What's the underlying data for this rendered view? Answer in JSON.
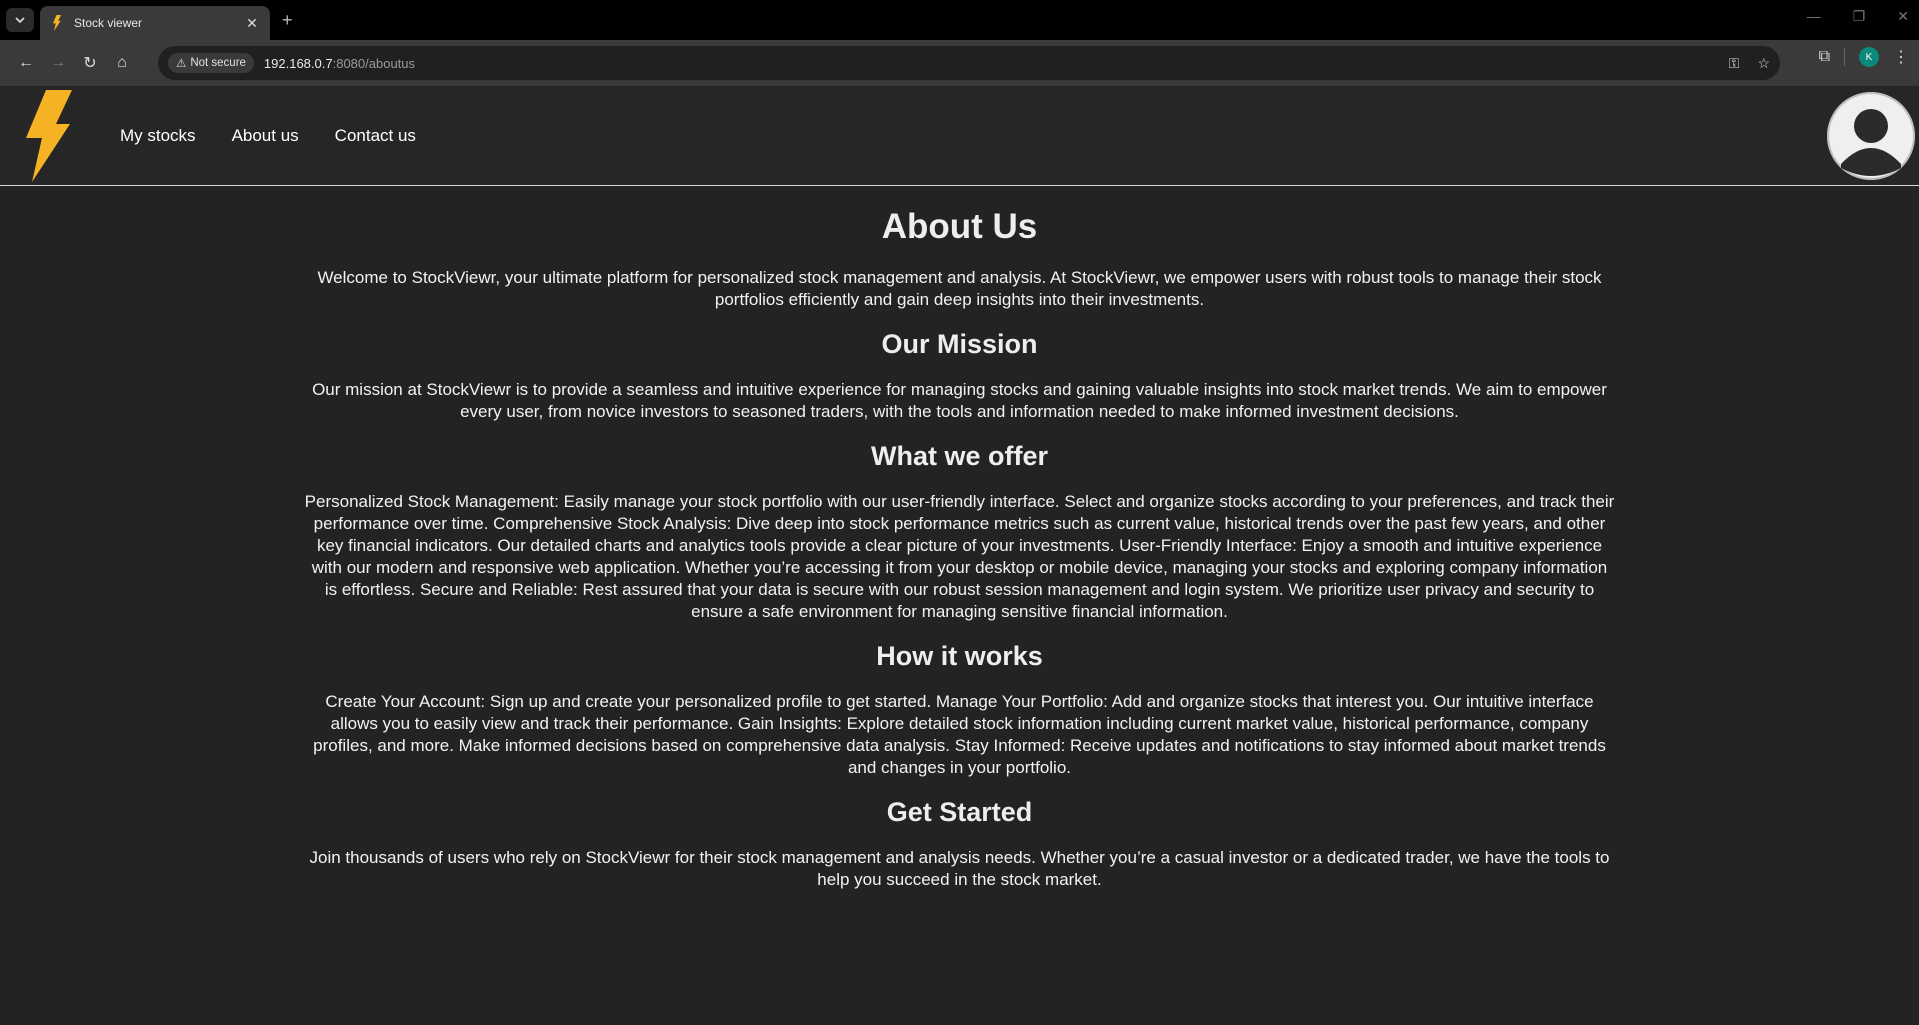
{
  "browser": {
    "tab_title": "Stock viewer",
    "security_label": "Not secure",
    "url_host": "192.168.0.7",
    "url_path": ":8080/aboutus",
    "profile_initial": "K"
  },
  "nav": {
    "items": [
      {
        "label": "My stocks"
      },
      {
        "label": "About us"
      },
      {
        "label": "Contact us"
      }
    ]
  },
  "colors": {
    "page_bg": "#232323",
    "logo": "#f5b324",
    "header_border": "#d8d8d8"
  },
  "about": {
    "title": "About Us",
    "intro": "Welcome to StockViewr, your ultimate platform for personalized stock management and analysis. At StockViewr, we empower users with robust tools to manage their stock portfolios efficiently and gain deep insights into their investments.",
    "sections": [
      {
        "heading": "Our Mission",
        "text": "Our mission at StockViewr is to provide a seamless and intuitive experience for managing stocks and gaining valuable insights into stock market trends. We aim to empower every user, from novice investors to seasoned traders, with the tools and information needed to make informed investment decisions."
      },
      {
        "heading": "What we offer",
        "text": "Personalized Stock Management: Easily manage your stock portfolio with our user-friendly interface. Select and organize stocks according to your preferences, and track their performance over time. Comprehensive Stock Analysis: Dive deep into stock performance metrics such as current value, historical trends over the past few years, and other key financial indicators. Our detailed charts and analytics tools provide a clear picture of your investments. User-Friendly Interface: Enjoy a smooth and intuitive experience with our modern and responsive web application. Whether you’re accessing it from your desktop or mobile device, managing your stocks and exploring company information is effortless. Secure and Reliable: Rest assured that your data is secure with our robust session management and login system. We prioritize user privacy and security to ensure a safe environment for managing sensitive financial information."
      },
      {
        "heading": "How it works",
        "text": "Create Your Account: Sign up and create your personalized profile to get started. Manage Your Portfolio: Add and organize stocks that interest you. Our intuitive interface allows you to easily view and track their performance. Gain Insights: Explore detailed stock information including current market value, historical performance, company profiles, and more. Make informed decisions based on comprehensive data analysis. Stay Informed: Receive updates and notifications to stay informed about market trends and changes in your portfolio."
      },
      {
        "heading": "Get Started",
        "text": "Join thousands of users who rely on StockViewr for their stock management and analysis needs. Whether you’re a casual investor or a dedicated trader, we have the tools to help you succeed in the stock market."
      }
    ]
  }
}
